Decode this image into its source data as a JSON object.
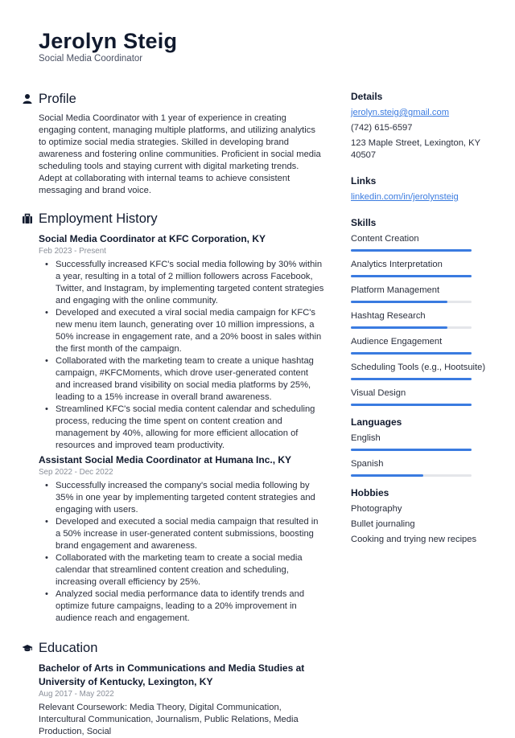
{
  "header": {
    "name": "Jerolyn Steig",
    "title": "Social Media Coordinator"
  },
  "profile": {
    "heading": "Profile",
    "icon": "person-icon",
    "text": "Social Media Coordinator with 1 year of experience in creating engaging content, managing multiple platforms, and utilizing analytics to optimize social media strategies. Skilled in developing brand awareness and fostering online communities. Proficient in social media scheduling tools and staying current with digital marketing trends. Adept at collaborating with internal teams to achieve consistent messaging and brand voice."
  },
  "employment": {
    "heading": "Employment History",
    "icon": "briefcase-icon",
    "jobs": [
      {
        "title": "Social Media Coordinator at KFC Corporation, KY",
        "dates": "Feb 2023 - Present",
        "bullets": [
          "Successfully increased KFC's social media following by 30% within a year, resulting in a total of 2 million followers across Facebook, Twitter, and Instagram, by implementing targeted content strategies and engaging with the online community.",
          "Developed and executed a viral social media campaign for KFC's new menu item launch, generating over 10 million impressions, a 50% increase in engagement rate, and a 20% boost in sales within the first month of the campaign.",
          "Collaborated with the marketing team to create a unique hashtag campaign, #KFCMoments, which drove user-generated content and increased brand visibility on social media platforms by 25%, leading to a 15% increase in overall brand awareness.",
          "Streamlined KFC's social media content calendar and scheduling process, reducing the time spent on content creation and management by 40%, allowing for more efficient allocation of resources and improved team productivity."
        ]
      },
      {
        "title": "Assistant Social Media Coordinator at Humana Inc., KY",
        "dates": "Sep 2022 - Dec 2022",
        "bullets": [
          "Successfully increased the company's social media following by 35% in one year by implementing targeted content strategies and engaging with users.",
          "Developed and executed a social media campaign that resulted in a 50% increase in user-generated content submissions, boosting brand engagement and awareness.",
          "Collaborated with the marketing team to create a social media calendar that streamlined content creation and scheduling, increasing overall efficiency by 25%.",
          "Analyzed social media performance data to identify trends and optimize future campaigns, leading to a 20% improvement in audience reach and engagement."
        ]
      }
    ]
  },
  "education": {
    "heading": "Education",
    "icon": "graduation-cap-icon",
    "items": [
      {
        "title": "Bachelor of Arts in Communications and Media Studies at University of Kentucky, Lexington, KY",
        "dates": "Aug 2017 - May 2022",
        "text": "Relevant Coursework: Media Theory, Digital Communication, Intercultural Communication, Journalism, Public Relations, Media Production, Social"
      }
    ]
  },
  "details": {
    "heading": "Details",
    "email": "jerolyn.steig@gmail.com",
    "phone": "(742) 615-6597",
    "address": "123 Maple Street, Lexington, KY 40507"
  },
  "links": {
    "heading": "Links",
    "items": [
      "linkedin.com/in/jerolynsteig"
    ]
  },
  "skills": {
    "heading": "Skills",
    "items": [
      {
        "label": "Content Creation",
        "level": 1.0
      },
      {
        "label": "Analytics Interpretation",
        "level": 1.0
      },
      {
        "label": "Platform Management",
        "level": 0.8
      },
      {
        "label": "Hashtag Research",
        "level": 0.8
      },
      {
        "label": "Audience Engagement",
        "level": 1.0
      },
      {
        "label": "Scheduling Tools (e.g., Hootsuite)",
        "level": 1.0
      },
      {
        "label": "Visual Design",
        "level": 1.0
      }
    ]
  },
  "languages": {
    "heading": "Languages",
    "items": [
      {
        "label": "English",
        "level": 1.0
      },
      {
        "label": "Spanish",
        "level": 0.6
      }
    ]
  },
  "hobbies": {
    "heading": "Hobbies",
    "items": [
      "Photography",
      "Bullet journaling",
      "Cooking and trying new recipes"
    ]
  },
  "colors": {
    "accent": "#3a7be0",
    "bar_track": "#e4e6ea",
    "heading": "#111a2e",
    "muted": "#8a8f99"
  }
}
